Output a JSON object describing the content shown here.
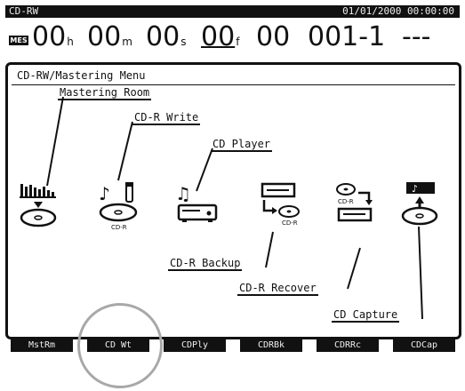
{
  "status_bar": {
    "mode": "CD-RW",
    "datetime": "01/01/2000 00:00:00"
  },
  "time_display": {
    "format_badge": "MES",
    "hours": "00",
    "hours_unit": "h",
    "minutes": "00",
    "minutes_unit": "m",
    "seconds": "00",
    "seconds_unit": "s",
    "frames": "00",
    "frames_unit": "f",
    "subframes": "00",
    "scene": "001-1",
    "marker": "---"
  },
  "menu": {
    "title": "CD-RW/Mastering Menu",
    "items": [
      {
        "label": "Mastering Room",
        "icon": "mastering-room-icon"
      },
      {
        "label": "CD-R Write",
        "icon": "cd-r-write-icon"
      },
      {
        "label": "CD Player",
        "icon": "cd-player-icon"
      },
      {
        "label": "CD-R Backup",
        "icon": "cd-r-backup-icon"
      },
      {
        "label": "CD-R Recover",
        "icon": "cd-r-recover-icon"
      },
      {
        "label": "CD Capture",
        "icon": "cd-capture-icon"
      }
    ],
    "cdr_tag": "CD-R"
  },
  "softkeys": [
    "MstRm",
    "CD Wt",
    "CDPly",
    "CDRBk",
    "CDRRc",
    "CDCap"
  ],
  "colors": {
    "lcd_ink": "#111111",
    "background": "#ffffff",
    "focus_ring": "#a8a8a8"
  }
}
